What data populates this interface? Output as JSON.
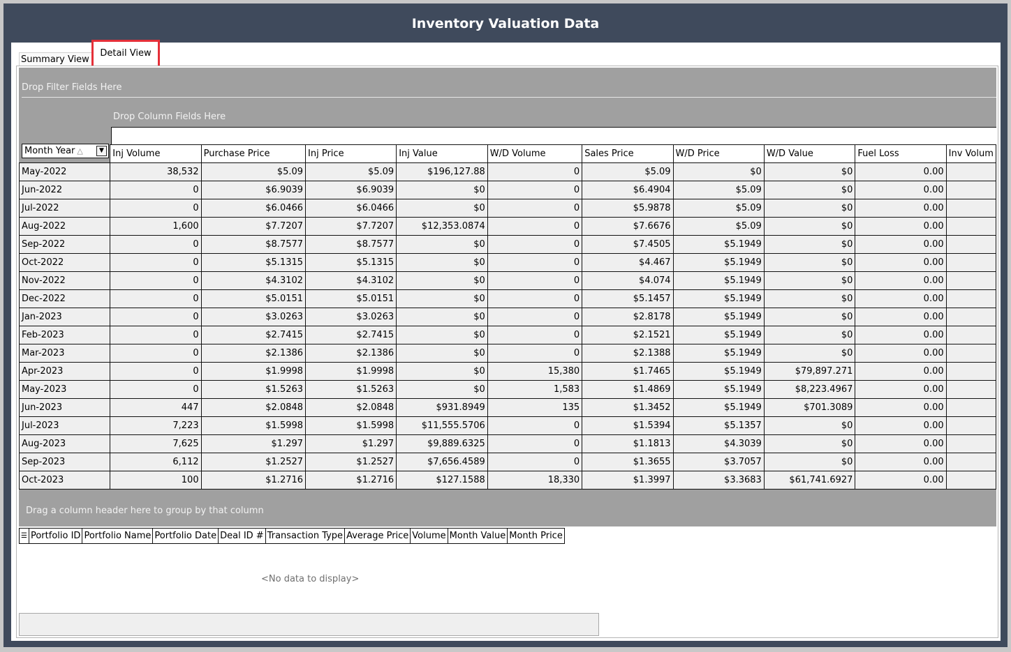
{
  "window": {
    "title": "Inventory Valuation Data"
  },
  "tabs": {
    "summary": "Summary View",
    "detail": "Detail View"
  },
  "pivot": {
    "filter_placeholder": "Drop Filter Fields Here",
    "column_placeholder": "Drop Column Fields Here",
    "row_field": "Month Year",
    "row_field_sort_icon": "sort-ascending-icon",
    "columns": [
      "Inj Volume",
      "Purchase Price",
      "Inj Price",
      "Inj Value",
      "W/D Volume",
      "Sales Price",
      "W/D Price",
      "W/D Value",
      "Fuel Loss",
      "Inv Volum"
    ],
    "rows": [
      {
        "month": "May-2022",
        "cells": [
          "38,532",
          "$5.09",
          "$5.09",
          "$196,127.88",
          "0",
          "$5.09",
          "$0",
          "$0",
          "0.00",
          ""
        ]
      },
      {
        "month": "Jun-2022",
        "cells": [
          "0",
          "$6.9039",
          "$6.9039",
          "$0",
          "0",
          "$6.4904",
          "$5.09",
          "$0",
          "0.00",
          ""
        ]
      },
      {
        "month": "Jul-2022",
        "cells": [
          "0",
          "$6.0466",
          "$6.0466",
          "$0",
          "0",
          "$5.9878",
          "$5.09",
          "$0",
          "0.00",
          ""
        ]
      },
      {
        "month": "Aug-2022",
        "cells": [
          "1,600",
          "$7.7207",
          "$7.7207",
          "$12,353.0874",
          "0",
          "$7.6676",
          "$5.09",
          "$0",
          "0.00",
          ""
        ]
      },
      {
        "month": "Sep-2022",
        "cells": [
          "0",
          "$8.7577",
          "$8.7577",
          "$0",
          "0",
          "$7.4505",
          "$5.1949",
          "$0",
          "0.00",
          ""
        ]
      },
      {
        "month": "Oct-2022",
        "cells": [
          "0",
          "$5.1315",
          "$5.1315",
          "$0",
          "0",
          "$4.467",
          "$5.1949",
          "$0",
          "0.00",
          ""
        ]
      },
      {
        "month": "Nov-2022",
        "cells": [
          "0",
          "$4.3102",
          "$4.3102",
          "$0",
          "0",
          "$4.074",
          "$5.1949",
          "$0",
          "0.00",
          ""
        ]
      },
      {
        "month": "Dec-2022",
        "cells": [
          "0",
          "$5.0151",
          "$5.0151",
          "$0",
          "0",
          "$5.1457",
          "$5.1949",
          "$0",
          "0.00",
          ""
        ]
      },
      {
        "month": "Jan-2023",
        "cells": [
          "0",
          "$3.0263",
          "$3.0263",
          "$0",
          "0",
          "$2.8178",
          "$5.1949",
          "$0",
          "0.00",
          ""
        ]
      },
      {
        "month": "Feb-2023",
        "cells": [
          "0",
          "$2.7415",
          "$2.7415",
          "$0",
          "0",
          "$2.1521",
          "$5.1949",
          "$0",
          "0.00",
          ""
        ]
      },
      {
        "month": "Mar-2023",
        "cells": [
          "0",
          "$2.1386",
          "$2.1386",
          "$0",
          "0",
          "$2.1388",
          "$5.1949",
          "$0",
          "0.00",
          ""
        ]
      },
      {
        "month": "Apr-2023",
        "cells": [
          "0",
          "$1.9998",
          "$1.9998",
          "$0",
          "15,380",
          "$1.7465",
          "$5.1949",
          "$79,897.271",
          "0.00",
          ""
        ]
      },
      {
        "month": "May-2023",
        "cells": [
          "0",
          "$1.5263",
          "$1.5263",
          "$0",
          "1,583",
          "$1.4869",
          "$5.1949",
          "$8,223.4967",
          "0.00",
          ""
        ]
      },
      {
        "month": "Jun-2023",
        "cells": [
          "447",
          "$2.0848",
          "$2.0848",
          "$931.8949",
          "135",
          "$1.3452",
          "$5.1949",
          "$701.3089",
          "0.00",
          ""
        ]
      },
      {
        "month": "Jul-2023",
        "cells": [
          "7,223",
          "$1.5998",
          "$1.5998",
          "$11,555.5706",
          "0",
          "$1.5394",
          "$5.1357",
          "$0",
          "0.00",
          ""
        ]
      },
      {
        "month": "Aug-2023",
        "cells": [
          "7,625",
          "$1.297",
          "$1.297",
          "$9,889.6325",
          "0",
          "$1.1813",
          "$4.3039",
          "$0",
          "0.00",
          ""
        ]
      },
      {
        "month": "Sep-2023",
        "cells": [
          "6,112",
          "$1.2527",
          "$1.2527",
          "$7,656.4589",
          "0",
          "$1.3655",
          "$3.7057",
          "$0",
          "0.00",
          ""
        ]
      },
      {
        "month": "Oct-2023",
        "cells": [
          "100",
          "$1.2716",
          "$1.2716",
          "$127.1588",
          "18,330",
          "$1.3997",
          "$3.3683",
          "$61,741.6927",
          "0.00",
          ""
        ]
      }
    ]
  },
  "group_panel": {
    "placeholder": "Drag a column header here to group by that column"
  },
  "detail_grid": {
    "menu_icon": "column-chooser-icon",
    "columns": [
      "Portfolio ID",
      "Portfolio Name",
      "Portfolio Date",
      "Deal ID #",
      "Transaction Type",
      "Average Price",
      "Volume",
      "Month Value",
      "Month Price"
    ],
    "empty_text": "<No data to display>"
  },
  "colors": {
    "titlebar": "#3f4a5c",
    "highlight": "#e53039",
    "pivot_bg": "#a0a0a0"
  }
}
